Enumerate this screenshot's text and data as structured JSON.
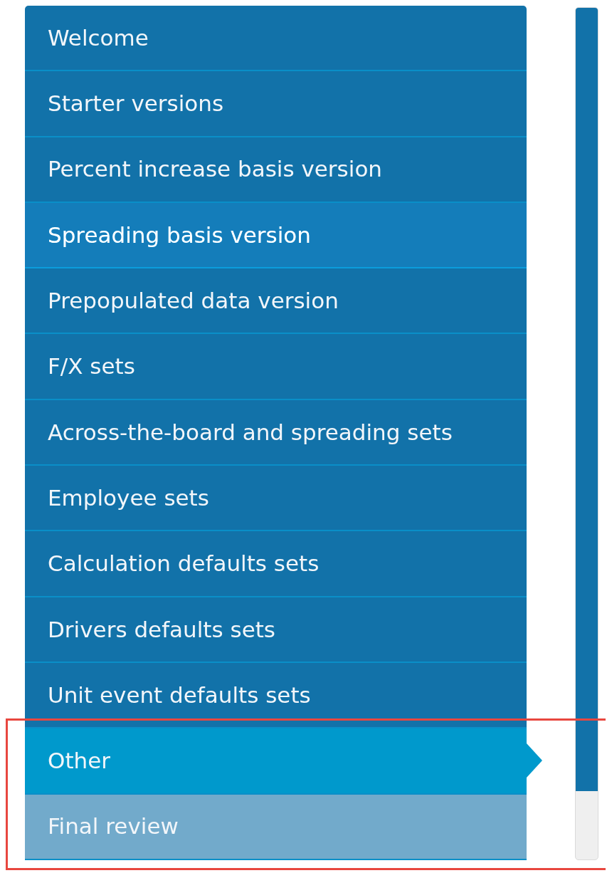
{
  "step_groups": [
    {
      "steps": [
        {
          "label": "Welcome",
          "selected": false,
          "hovered": false,
          "disabled": false
        },
        {
          "label": "Starter versions",
          "selected": false,
          "hovered": false,
          "disabled": false
        },
        {
          "label": "Percent increase basis version",
          "selected": false,
          "hovered": false,
          "disabled": false
        },
        {
          "label": "Spreading basis version",
          "selected": false,
          "hovered": true,
          "disabled": false
        },
        {
          "label": "Prepopulated data version",
          "selected": false,
          "hovered": false,
          "disabled": false
        },
        {
          "label": "F/X sets",
          "selected": false,
          "hovered": false,
          "disabled": false
        },
        {
          "label": "Across-the-board and spreading sets",
          "selected": false,
          "hovered": false,
          "disabled": false
        },
        {
          "label": "Employee sets",
          "selected": false,
          "hovered": false,
          "disabled": false
        },
        {
          "label": "Calculation defaults sets",
          "selected": false,
          "hovered": false,
          "disabled": false
        },
        {
          "label": "Drivers defaults sets",
          "selected": false,
          "hovered": false,
          "disabled": false
        },
        {
          "label": "Unit event defaults sets",
          "selected": false,
          "hovered": false,
          "disabled": false
        }
      ]
    },
    {
      "highlighted": true,
      "steps": [
        {
          "label": "Other",
          "selected": true,
          "hovered": false,
          "disabled": false
        },
        {
          "label": "Final review",
          "selected": false,
          "hovered": false,
          "disabled": true
        }
      ]
    }
  ],
  "progress": {
    "level": 0.92
  }
}
